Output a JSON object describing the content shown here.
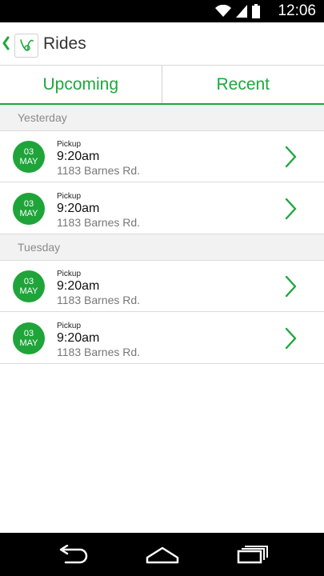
{
  "status_bar": {
    "time": "12:06"
  },
  "header": {
    "title": "Rides",
    "logo_icon": "app-logo-icon",
    "back_icon": "chevron-left-icon"
  },
  "tabs": [
    {
      "label": "Upcoming"
    },
    {
      "label": "Recent"
    }
  ],
  "sections": [
    {
      "title": "Yesterday",
      "rides": [
        {
          "day": "03",
          "month": "MAY",
          "label": "Pickup",
          "time": "9:20am",
          "address": "1183 Barnes Rd."
        },
        {
          "day": "03",
          "month": "MAY",
          "label": "Pickup",
          "time": "9:20am",
          "address": "1183 Barnes Rd."
        }
      ]
    },
    {
      "title": "Tuesday",
      "rides": [
        {
          "day": "03",
          "month": "MAY",
          "label": "Pickup",
          "time": "9:20am",
          "address": "1183 Barnes Rd."
        },
        {
          "day": "03",
          "month": "MAY",
          "label": "Pickup",
          "time": "9:20am",
          "address": "1183 Barnes Rd."
        }
      ]
    }
  ],
  "colors": {
    "accent": "#1ea83c",
    "status_bar": "#000000",
    "nav_bar": "#000000"
  }
}
